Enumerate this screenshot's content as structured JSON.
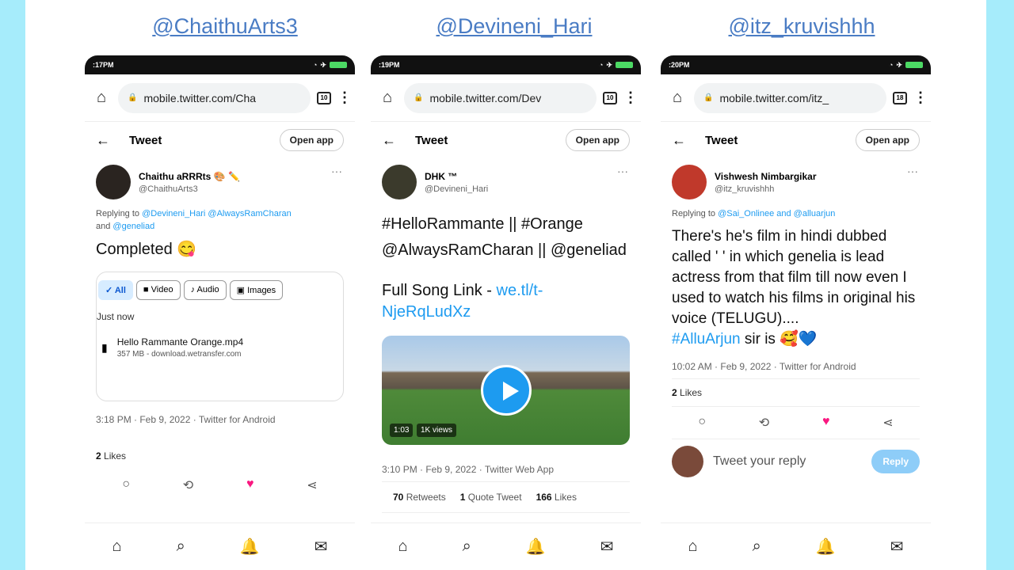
{
  "headers": [
    "@ChaithuArts3",
    "@Devineni_Hari",
    "@itz_kruvishhh"
  ],
  "phones": [
    {
      "status_time": ":17PM",
      "url": "mobile.twitter.com/Cha",
      "tab_count": "10",
      "tweet_title": "Tweet",
      "open_app": "Open app",
      "author_name": "Chaithu aRRRts 🎨 ✏️",
      "author_handle": "@ChaithuArts3",
      "reply_prefix": "Replying to ",
      "reply_targets": "@Devineni_Hari @AlwaysRamCharan",
      "reply_and": "and ",
      "reply_last": "@geneliad",
      "text": "Completed 😋",
      "chips": [
        "✓ All",
        "■ Video",
        "♪ Audio",
        "▣ Images"
      ],
      "just_now": "Just now",
      "file_name": "Hello Rammante Orange.mp4",
      "file_sub": "357 MB - download.wetransfer.com",
      "meta": "3:18 PM · Feb 9, 2022 · Twitter for Android",
      "likes_count": "2",
      "likes_label": " Likes"
    },
    {
      "status_time": ":19PM",
      "url": "mobile.twitter.com/Dev",
      "tab_count": "10",
      "tweet_title": "Tweet",
      "open_app": "Open app",
      "author_name": "DHK ™",
      "author_handle": "@Devineni_Hari",
      "hashtags_1": "#HelloRammante || #Orange",
      "hashtags_2": "@AlwaysRamCharan || @geneliad",
      "song_label": "Full Song Link - ",
      "song_link": "we.tl/t-NjeRqLudXz",
      "video_time": "1:03",
      "video_views": "1K views",
      "meta": "3:10 PM · Feb 9, 2022 · Twitter Web App",
      "retweets_count": "70",
      "retweets_label": " Retweets",
      "quotes_count": "1",
      "quotes_label": " Quote Tweet",
      "likes_count": "166",
      "likes_label": " Likes"
    },
    {
      "status_time": ":20PM",
      "url": "mobile.twitter.com/itz_",
      "tab_count": "18",
      "tweet_title": "Tweet",
      "open_app": "Open app",
      "author_name": "Vishwesh Nimbargikar",
      "author_handle": "@itz_kruvishhh",
      "reply_prefix": "Replying to ",
      "reply_targets": "@Sai_Onlinee and @alluarjun",
      "text": "There's he's film in hindi dubbed called ' ' in which genelia is lead actress from that film till now even I used to watch his films in original his voice (TELUGU)....",
      "hashtag": "#AlluArjun",
      "text_end": " sir is 🥰💙",
      "meta": "10:02 AM · Feb 9, 2022 · Twitter for Android",
      "likes_count": "2",
      "likes_label": " Likes",
      "reply_placeholder": "Tweet your reply",
      "reply_button": "Reply"
    }
  ],
  "icons": {
    "home": "⌂",
    "back": "←",
    "more": "···",
    "kebab": "⋮",
    "reply": "○",
    "retweet": "⟲",
    "like": "♥",
    "share": "⋖",
    "nav_home": "⌂",
    "nav_search": "⌕",
    "nav_bell": "🔔",
    "nav_mail": "✉"
  }
}
